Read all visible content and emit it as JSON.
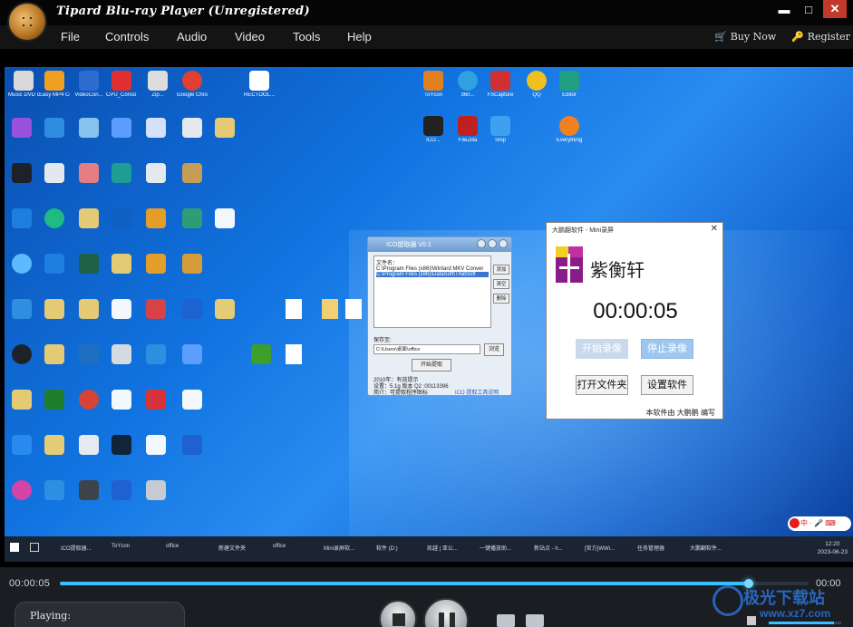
{
  "window": {
    "title": "Tipard Blu-ray Player (Unregistered)",
    "minimize": "▬",
    "maximize": "□",
    "close": "✕"
  },
  "menu": {
    "items": [
      "File",
      "Controls",
      "Audio",
      "Video",
      "Tools",
      "Help"
    ],
    "buy_now": "Buy Now",
    "register": "Register"
  },
  "desktop_icons": [
    {
      "label": "Music DVD Creator",
      "color": "#d9d9d9"
    },
    {
      "label": "Easy MP4 Converter",
      "color": "#f0a020"
    },
    {
      "label": "VideoCon...",
      "color": "#2d6cd0"
    },
    {
      "label": "CPU_Conso...",
      "color": "#e03030"
    },
    {
      "label": "Zip...",
      "color": "#ddd"
    },
    {
      "label": "Google Chrome (2)",
      "color": "#e04030"
    },
    {
      "label": "RECTOOL... 12-01.pst",
      "color": "#ffffff"
    },
    {
      "label": "ToYcon",
      "color": "#e08020"
    },
    {
      "label": "360...",
      "color": "#30a0e0"
    },
    {
      "label": "FSCapture",
      "color": "#d03030"
    },
    {
      "label": "QQ",
      "color": "#f0c020"
    },
    {
      "label": "Editor",
      "color": "#20a080"
    },
    {
      "label": "ICO...",
      "color": "#222222"
    },
    {
      "label": "FileZilla",
      "color": "#c02020"
    },
    {
      "label": "Snip",
      "color": "#40a0f0"
    },
    {
      "label": "Everything",
      "color": "#f08020"
    }
  ],
  "ico_window": {
    "title": "ICO提取器 V0.1",
    "list_header": "文件名：",
    "rows": [
      "C:\\Program Files (x86)\\Wintard MKV Conver",
      "C:\\Program Files (x86)\\DataSoft\\ThatSoft"
    ],
    "side_buttons": [
      "添加",
      "清空",
      "删除"
    ],
    "save_label": "保存至:",
    "save_path": "C:\\Users\\桌面\\office",
    "browse": "浏览",
    "start": "开始提取",
    "info1": "2010年：有效提示",
    "info2": "设置：5.1g 版本 Q2 :00113396",
    "info3": "简介：可提取程序图标",
    "link": "ICO 提取工具说明"
  },
  "rec_window": {
    "title": "大鹏翻软件 - Mini录屏",
    "close": "✕",
    "brand": "紫衡轩",
    "time": "00:00:05",
    "btn_start": "开始录像",
    "btn_stop": "停止录像",
    "btn_open": "打开文件夹",
    "btn_settings": "设置软件",
    "footer": "本软件由 大鹏鹏 编写"
  },
  "taskbar": {
    "items": [
      "ICO提取器...",
      "ToYcon",
      "office",
      "新建文件夹",
      "office",
      "Mini录屏软...",
      "软件 (D:)",
      "凯越 | 亚公...",
      "一键播放助...",
      "新站点 - h...",
      "[官方]WWi...",
      "任务管理器",
      "大鹏翻软件..."
    ],
    "time": "12:20",
    "date": "2023-06-23",
    "ime": "中 · 🎤 ⌨"
  },
  "player": {
    "time_current": "00:00:05",
    "time_total": "00:00",
    "progress": 0.92,
    "volume": 0.9,
    "status": "Playing:"
  },
  "watermark": {
    "text": "极光下载站",
    "url": "www.xz7.com"
  }
}
